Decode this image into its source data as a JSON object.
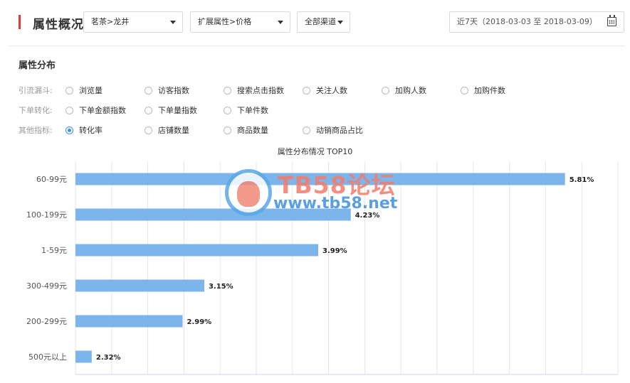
{
  "header": {
    "title": "属性概况",
    "category_select": "茗茶>龙井",
    "attribute_select": "扩展属性>价格",
    "channel_select": "全部渠道",
    "date_range": "近7天（2018-03-03 至 2018-03-09）",
    "accent_color": "#e4393c"
  },
  "section": {
    "title": "属性分布",
    "rows": [
      {
        "label": "引流漏斗:",
        "options": [
          {
            "label": "浏览量",
            "checked": false
          },
          {
            "label": "访客指数",
            "checked": false
          },
          {
            "label": "搜索点击指数",
            "checked": false
          },
          {
            "label": "关注人数",
            "checked": false
          },
          {
            "label": "加购人数",
            "checked": false
          },
          {
            "label": "加购件数",
            "checked": false
          }
        ]
      },
      {
        "label": "下单转化:",
        "options": [
          {
            "label": "下单金额指数",
            "checked": false
          },
          {
            "label": "下单量指数",
            "checked": false
          },
          {
            "label": "下单件数",
            "checked": false
          }
        ]
      },
      {
        "label": "其他指标:",
        "options": [
          {
            "label": "转化率",
            "checked": true
          },
          {
            "label": "店铺数量",
            "checked": false
          },
          {
            "label": "商品数量",
            "checked": false
          },
          {
            "label": "动销商品占比",
            "checked": false
          }
        ]
      }
    ]
  },
  "chart_data": {
    "type": "bar",
    "orientation": "horizontal",
    "title": "属性分布情况 TOP10",
    "categories": [
      "60-99元",
      "100-199元",
      "1-59元",
      "300-499元",
      "200-299元",
      "500元以上"
    ],
    "values": [
      5.81,
      4.23,
      3.99,
      3.15,
      2.99,
      2.32
    ],
    "value_labels": [
      "5.81%",
      "4.23%",
      "3.99%",
      "3.15%",
      "2.99%",
      "2.32%"
    ],
    "xlim": [
      2.2,
      6.2
    ],
    "grid": true,
    "bar_color": "#7cb5ec"
  },
  "watermark": {
    "line1": "TB58论坛",
    "line2": "www.tb58.net"
  }
}
